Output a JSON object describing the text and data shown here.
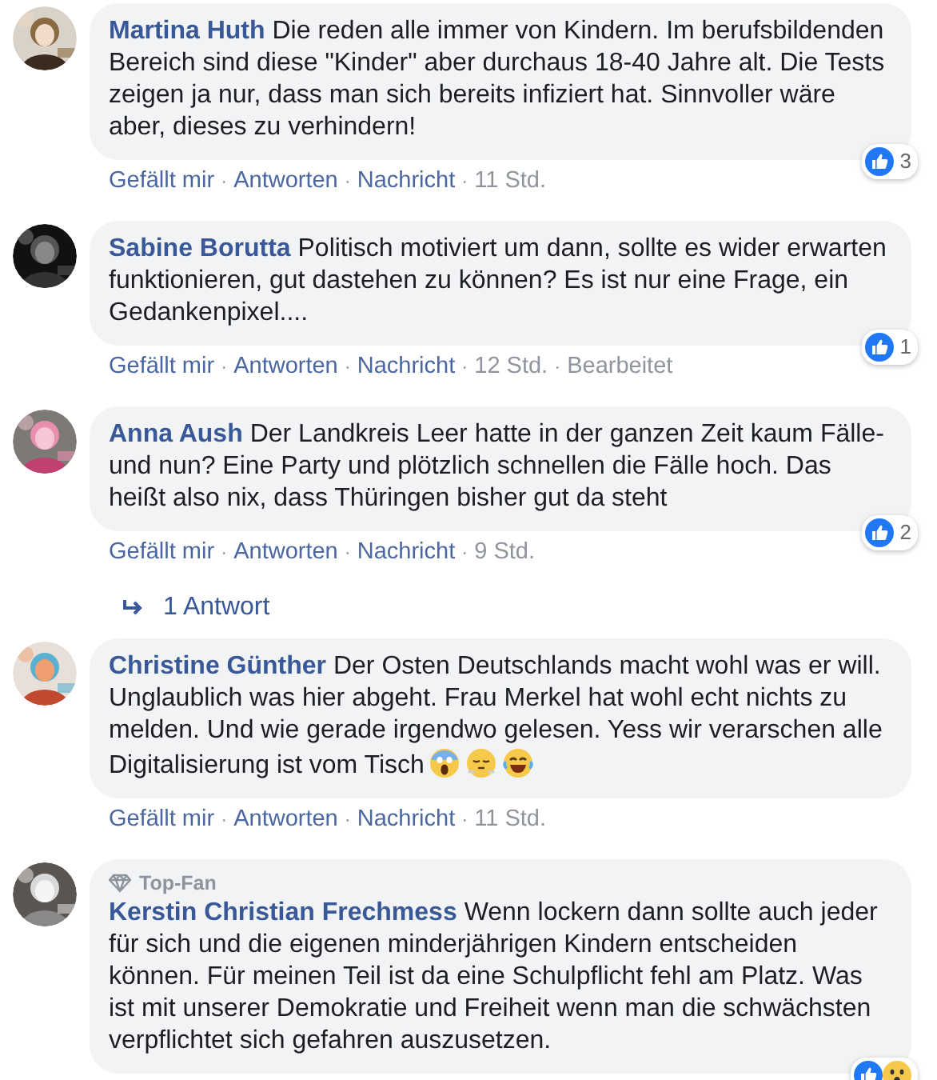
{
  "separator": "·",
  "comments": [
    {
      "author": "Martina Huth",
      "text": "Die reden alle immer von Kindern. Im berufsbildenden Bereich sind diese \"Kinder\" aber durchaus 18-40 Jahre alt. Die Tests zeigen ja nur, dass man sich bereits infiziert hat. Sinnvoller wäre aber, dieses zu verhindern!",
      "reactions": {
        "kinds": [
          {
            "kind": "like"
          }
        ],
        "count": "3"
      },
      "actions": [
        {
          "label": "Gefällt mir",
          "kind": "link"
        },
        {
          "label": "Antworten",
          "kind": "link"
        },
        {
          "label": "Nachricht",
          "kind": "link"
        },
        {
          "label": "11 Std.",
          "kind": "meta"
        }
      ]
    },
    {
      "author": "Sabine Borutta",
      "text": "Politisch motiviert um dann, sollte es wider erwarten funktionieren, gut dastehen zu können? Es ist nur eine Frage, ein Gedankenpixel....",
      "reactions": {
        "kinds": [
          {
            "kind": "like"
          }
        ],
        "count": "1"
      },
      "actions": [
        {
          "label": "Gefällt mir",
          "kind": "link"
        },
        {
          "label": "Antworten",
          "kind": "link"
        },
        {
          "label": "Nachricht",
          "kind": "link"
        },
        {
          "label": "12 Std.",
          "kind": "meta"
        },
        {
          "label": "Bearbeitet",
          "kind": "meta"
        }
      ]
    },
    {
      "author": "Anna Aush",
      "text": "Der Landkreis Leer hatte in der ganzen Zeit kaum Fälle- und nun? Eine Party und plötzlich schnellen die Fälle hoch. Das heißt also nix, dass Thüringen bisher gut da steht",
      "reactions": {
        "kinds": [
          {
            "kind": "like"
          }
        ],
        "count": "2"
      },
      "actions": [
        {
          "label": "Gefällt mir",
          "kind": "link"
        },
        {
          "label": "Antworten",
          "kind": "link"
        },
        {
          "label": "Nachricht",
          "kind": "link"
        },
        {
          "label": "9 Std.",
          "kind": "meta"
        }
      ],
      "replies": "1 Antwort"
    },
    {
      "author": "Christine Günther",
      "text": "Der Osten Deutschlands macht wohl was er will. Unglaublich was hier abgeht. Frau Merkel hat wohl echt nichts zu melden. Und wie gerade irgendwo gelesen. Yess wir verarschen alle Digitalisierung ist vom Tisch",
      "emojis": [
        {
          "kind": "scream"
        },
        {
          "kind": "huff"
        },
        {
          "kind": "joy"
        }
      ],
      "actions": [
        {
          "label": "Gefällt mir",
          "kind": "link"
        },
        {
          "label": "Antworten",
          "kind": "link"
        },
        {
          "label": "Nachricht",
          "kind": "link"
        },
        {
          "label": "11 Std.",
          "kind": "meta"
        }
      ]
    },
    {
      "badge": "Top-Fan",
      "author": "Kerstin Christian Frechmess",
      "text": "Wenn lockern dann sollte auch jeder für sich und die eigenen minderjährigen Kindern entscheiden können. Für meinen Teil ist da eine Schulpflicht fehl am Platz. Was ist mit unserer Demokratie und Freiheit wenn man die schwächsten verpflichtet sich gefahren auszusetzen.",
      "reactions": {
        "kinds": [
          {
            "kind": "like"
          },
          {
            "kind": "wow"
          }
        ]
      }
    }
  ]
}
